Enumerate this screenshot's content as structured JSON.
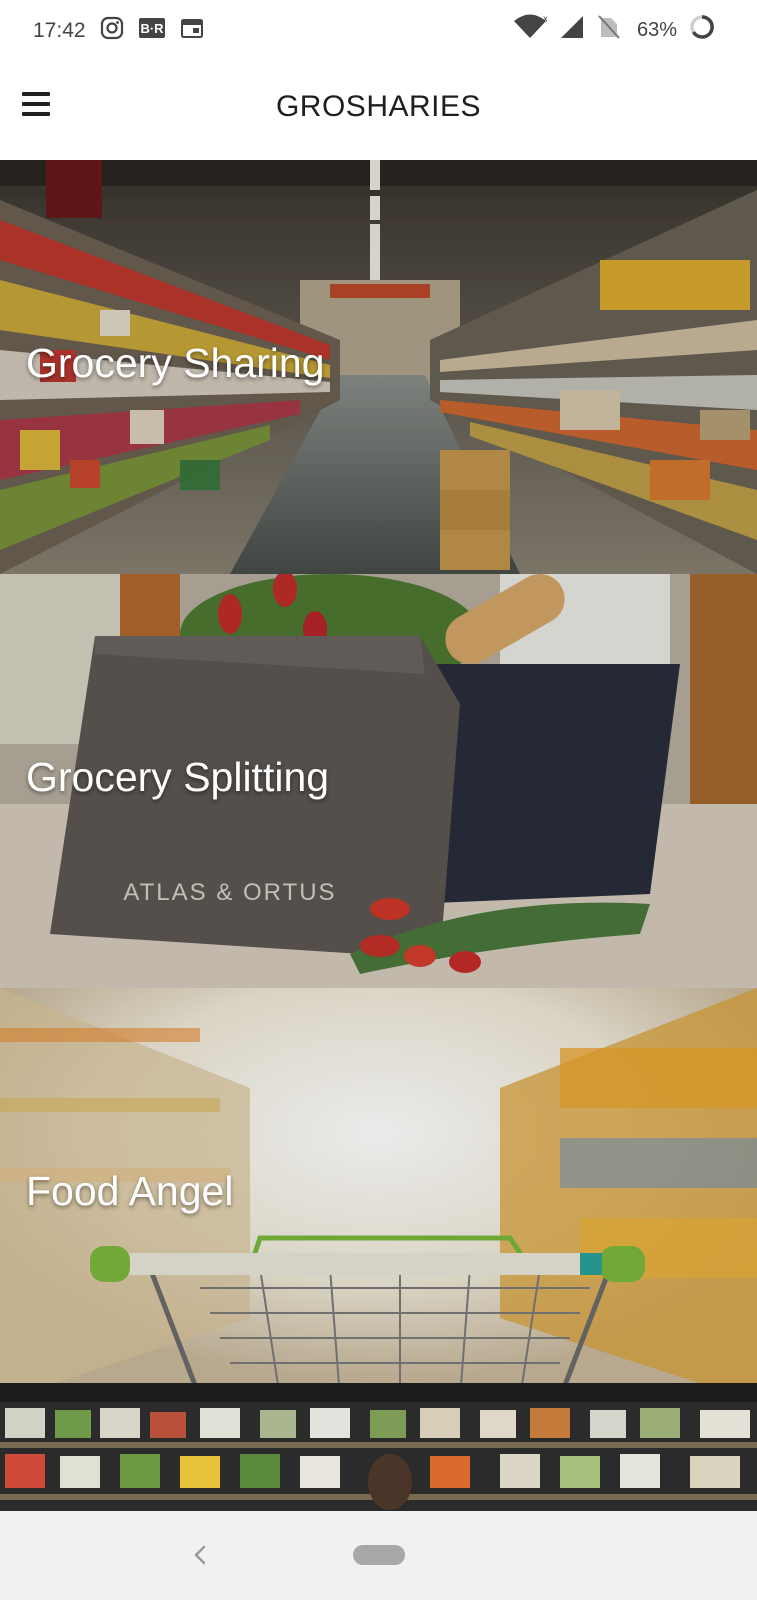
{
  "status_bar": {
    "time": "17:42",
    "battery_percent": "63%",
    "left_icons": [
      "instagram-icon",
      "br-icon",
      "calendar-icon"
    ],
    "right_icons": [
      "wifi-icon",
      "signal-icon",
      "no-sim-icon",
      "battery-icon"
    ]
  },
  "app_bar": {
    "title": "GROSHARIES",
    "menu_icon": "hamburger-menu-icon"
  },
  "cards": [
    {
      "label": "Grocery Sharing",
      "image": "supermarket-aisle"
    },
    {
      "label": "Grocery Splitting",
      "image": "tote-bag-with-bread-and-tulips"
    },
    {
      "label": "Food Angel",
      "image": "shopping-cart-in-aisle"
    }
  ],
  "card_2_bag_print": "ATLAS & ORTUS",
  "nav_bar": {
    "back_icon": "back-chevron-icon",
    "home_icon": "home-pill-icon"
  },
  "colors": {
    "app_bar_bg": "#ffffff",
    "title_text": "#1f1f1f",
    "card_label_text": "#ffffff",
    "nav_bar_bg": "#f1f1f1"
  }
}
